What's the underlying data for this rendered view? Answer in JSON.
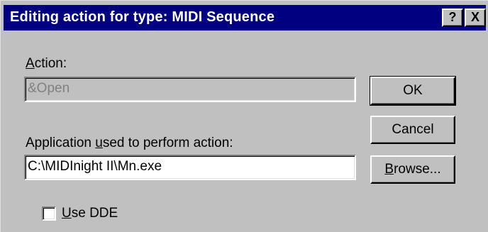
{
  "window": {
    "title": "Editing action for type: MIDI Sequence",
    "help_label": "?",
    "close_label": "X"
  },
  "action": {
    "label_underlined": "A",
    "label_rest": "ction:",
    "value": "&Open"
  },
  "application": {
    "label_prefix": "Application ",
    "label_underlined": "u",
    "label_rest": "sed to perform action:",
    "value": "C:\\MIDInight II\\Mn.exe"
  },
  "buttons": {
    "ok": "OK",
    "cancel": "Cancel",
    "browse_underlined": "B",
    "browse_rest": "rowse..."
  },
  "dde": {
    "label_underlined": "U",
    "label_rest": "se DDE",
    "checked": false
  }
}
